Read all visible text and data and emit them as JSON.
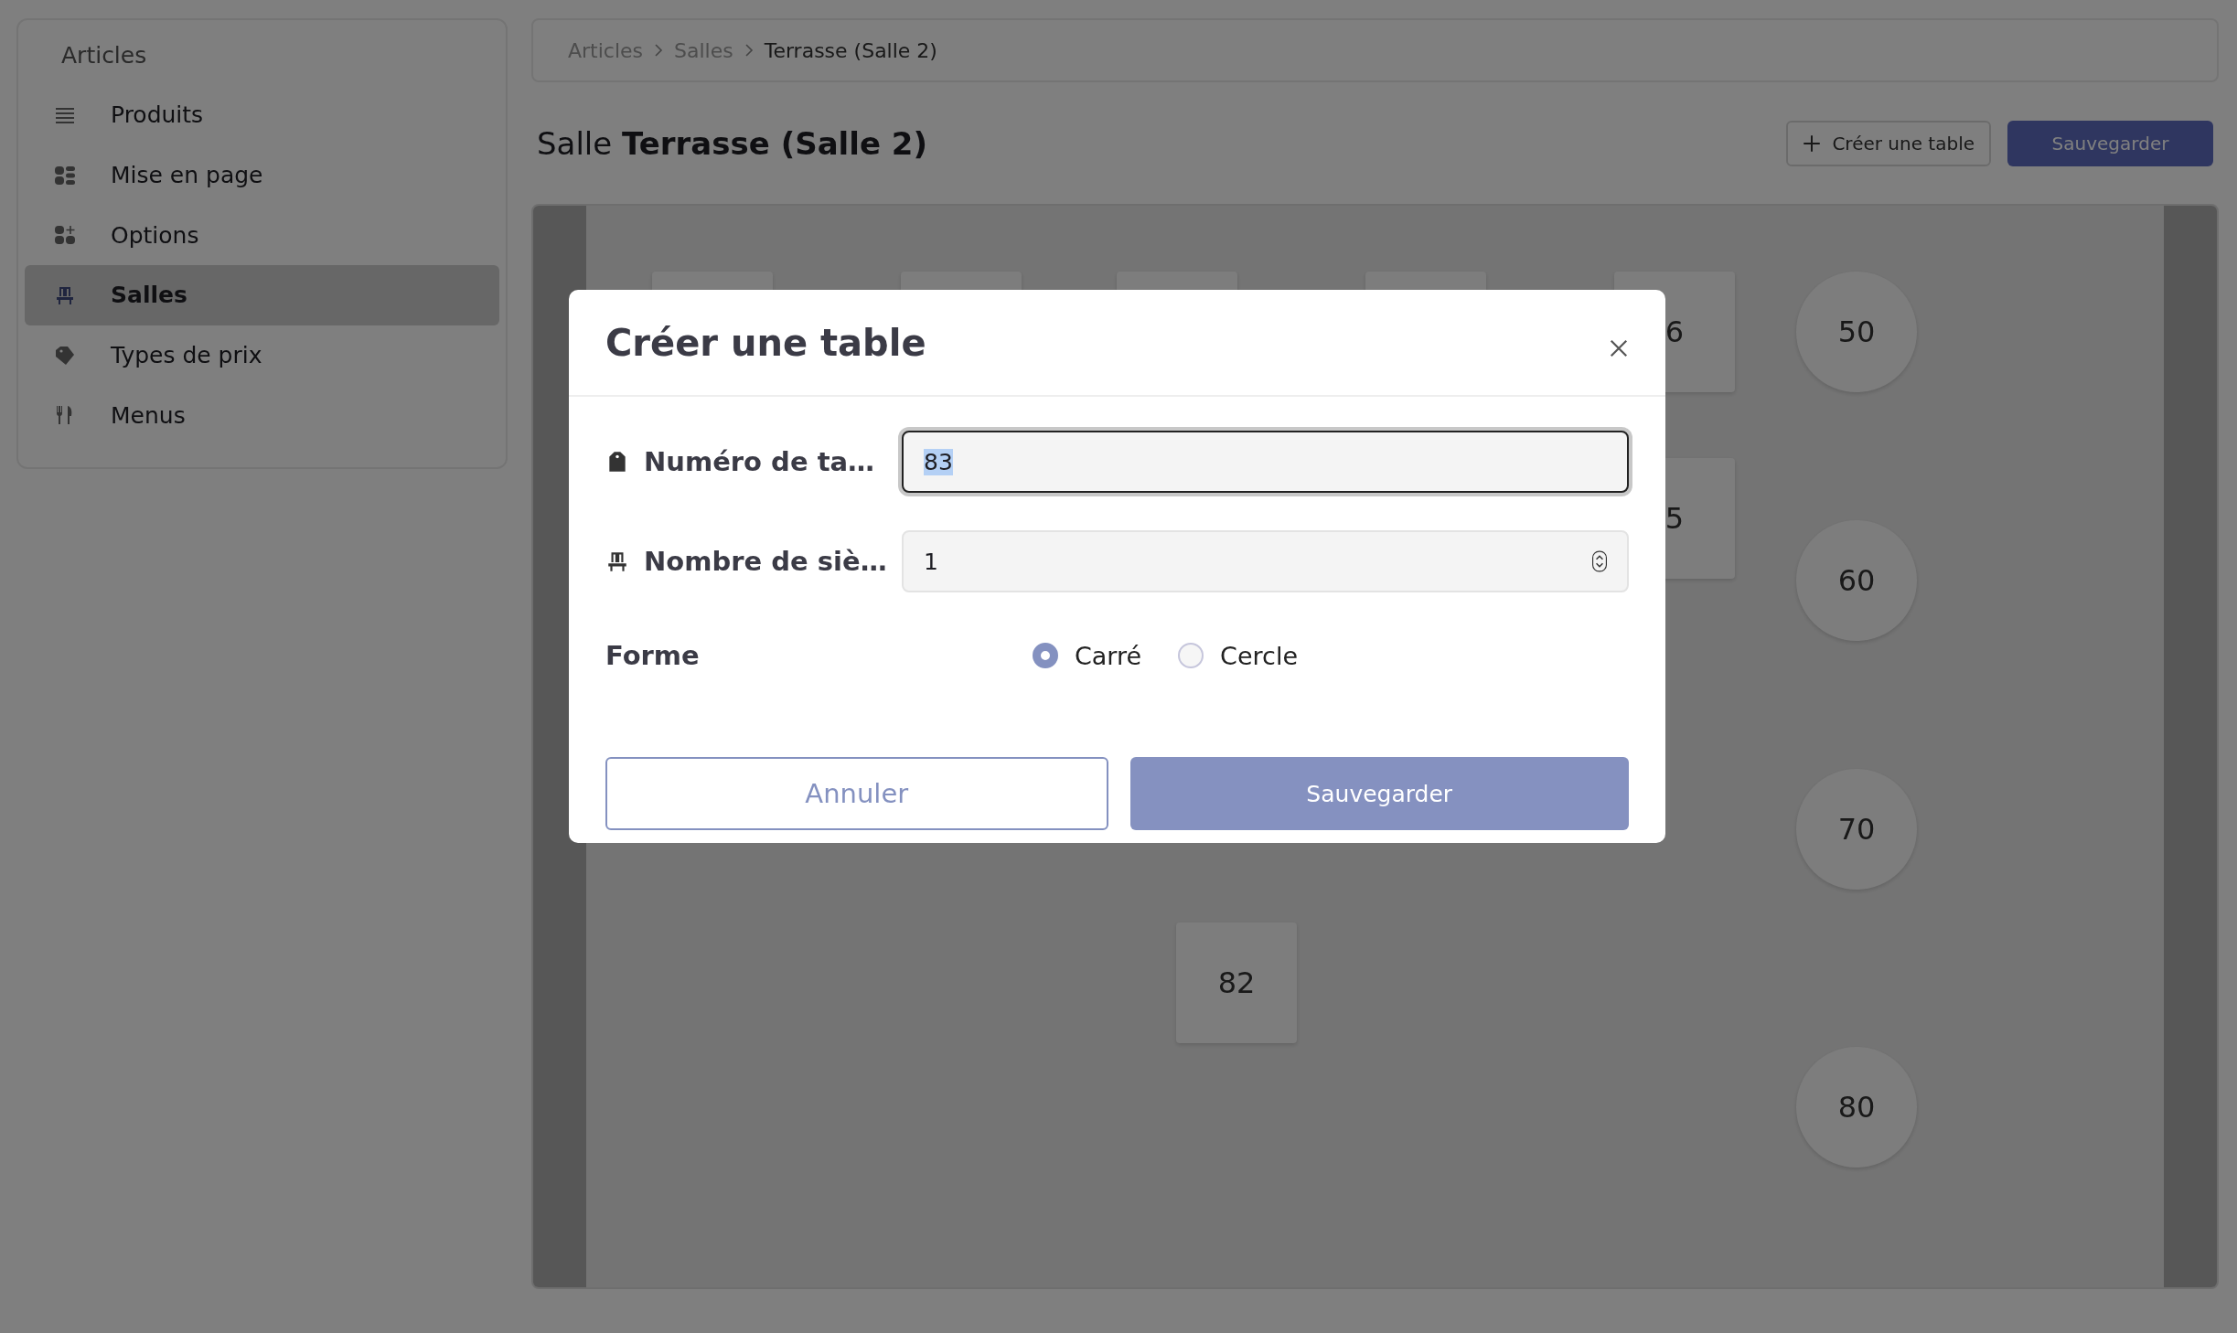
{
  "sidebar": {
    "heading": "Articles",
    "items": [
      {
        "label": "Produits",
        "selected": false
      },
      {
        "label": "Mise en page",
        "selected": false
      },
      {
        "label": "Options",
        "selected": false
      },
      {
        "label": "Salles",
        "selected": true
      },
      {
        "label": "Types de prix",
        "selected": false
      },
      {
        "label": "Menus",
        "selected": false
      }
    ]
  },
  "breadcrumb": [
    {
      "label": "Articles",
      "current": false
    },
    {
      "label": "Salles",
      "current": false
    },
    {
      "label": "Terrasse (Salle 2)",
      "current": true
    }
  ],
  "page_title": {
    "prefix": "Salle",
    "name": "Terrasse (Salle 2)"
  },
  "actions": {
    "create": "Créer une table",
    "save": "Sauvegarder"
  },
  "tables": [
    {
      "kind": "square"
    },
    {
      "kind": "square"
    },
    {
      "kind": "square"
    },
    {
      "kind": "square"
    },
    {
      "kind": "square",
      "label": "6"
    },
    {
      "kind": "circle",
      "label": "50"
    },
    {
      "kind": "square",
      "label": "5"
    },
    {
      "kind": "circle",
      "label": "60"
    },
    {
      "kind": "circle",
      "label": "70"
    },
    {
      "kind": "square",
      "label": "82"
    },
    {
      "kind": "circle",
      "label": "80"
    }
  ],
  "dialog": {
    "title": "Créer une table",
    "fields": [
      {
        "label": "Numéro de ta…",
        "kind": "text",
        "value": "83",
        "focused": true
      },
      {
        "label": "Nombre de siè…",
        "kind": "number",
        "value": "1",
        "focused": false
      }
    ],
    "shape": {
      "label": "Forme",
      "options": [
        {
          "label": "Carré",
          "selected": true
        },
        {
          "label": "Cercle",
          "selected": false
        }
      ]
    },
    "cancel": "Annuler",
    "save": "Sauvegarder"
  }
}
